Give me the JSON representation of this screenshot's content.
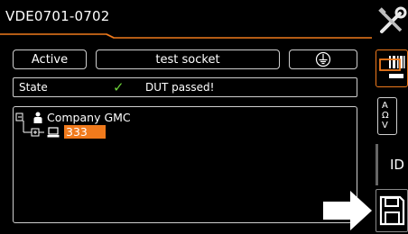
{
  "window": {
    "title": "VDE0701-0702"
  },
  "buttons": {
    "active_label": "Active",
    "test_socket_label": "test socket"
  },
  "status": {
    "label": "State",
    "message": "DUT passed!"
  },
  "tree": {
    "root_label": "Company GMC",
    "child_label": "333"
  },
  "sidebar": {
    "items": [
      {
        "icon": "tools-icon"
      },
      {
        "icon": "barcode-icon"
      },
      {
        "icon": "units-icon",
        "lines": [
          "A",
          "Ω",
          "V"
        ]
      },
      {
        "label": "ID"
      },
      {
        "icon": "save-icon"
      }
    ]
  },
  "colors": {
    "accent": "#f07a1c",
    "pass": "#6dd13a",
    "background": "#000000"
  }
}
